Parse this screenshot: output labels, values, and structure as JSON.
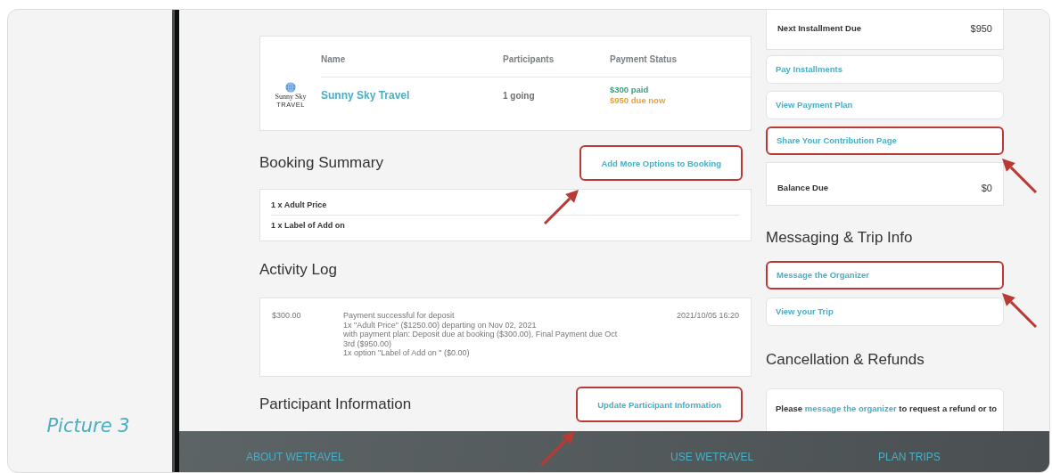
{
  "caption": "Picture 3",
  "bookings_table": {
    "columns": [
      "Name",
      "Participants",
      "Payment Status"
    ],
    "rows": [
      {
        "logo_lines": [
          "Sunny Sky",
          "TRAVEL"
        ],
        "name": "Sunny Sky Travel",
        "participants": "1 going",
        "payment_status": [
          {
            "text": "$300 paid",
            "kind": "paid"
          },
          {
            "text": "$950 due now",
            "kind": "due"
          }
        ]
      }
    ]
  },
  "booking_summary": {
    "heading": "Booking Summary",
    "action": {
      "label": "Add More Options to Booking",
      "highlighted": true
    },
    "items": [
      "1 x Adult Price",
      "1 x Label of Add on"
    ]
  },
  "activity_log": {
    "heading": "Activity Log",
    "entries": [
      {
        "amount": "$300.00",
        "lines": [
          "Payment successful for deposit",
          "1x \"Adult Price\" ($1250.00) departing on Nov 02, 2021",
          "with payment plan: Deposit due at booking ($300.00), Final Payment due Oct",
          "3rd ($950.00)",
          "1x option \"Label of Add on \" ($0.00)"
        ],
        "timestamp": "2021/10/05 16:20"
      }
    ]
  },
  "participant_information": {
    "heading": "Participant Information",
    "action": {
      "label": "Update Participant Information",
      "highlighted": true
    }
  },
  "payment": {
    "next_installment": {
      "label": "Next Installment Due",
      "value": "$950"
    },
    "actions": [
      {
        "label": "Pay Installments",
        "highlighted": false
      },
      {
        "label": "View Payment Plan",
        "highlighted": false
      },
      {
        "label": "Share Your Contribution Page",
        "highlighted": true
      }
    ],
    "balance": {
      "label": "Balance Due",
      "value": "$0"
    }
  },
  "messaging": {
    "heading": "Messaging & Trip Info",
    "actions": [
      {
        "label": "Message the Organizer",
        "highlighted": true
      },
      {
        "label": "View your Trip",
        "highlighted": false
      }
    ]
  },
  "cancellation": {
    "heading": "Cancellation & Refunds",
    "text_before": "Please ",
    "link": "message the organizer",
    "text_after": " to request a refund or to"
  },
  "footer": {
    "links": [
      "ABOUT WETRAVEL",
      "USE WETRAVEL",
      "PLAN TRIPS"
    ]
  }
}
